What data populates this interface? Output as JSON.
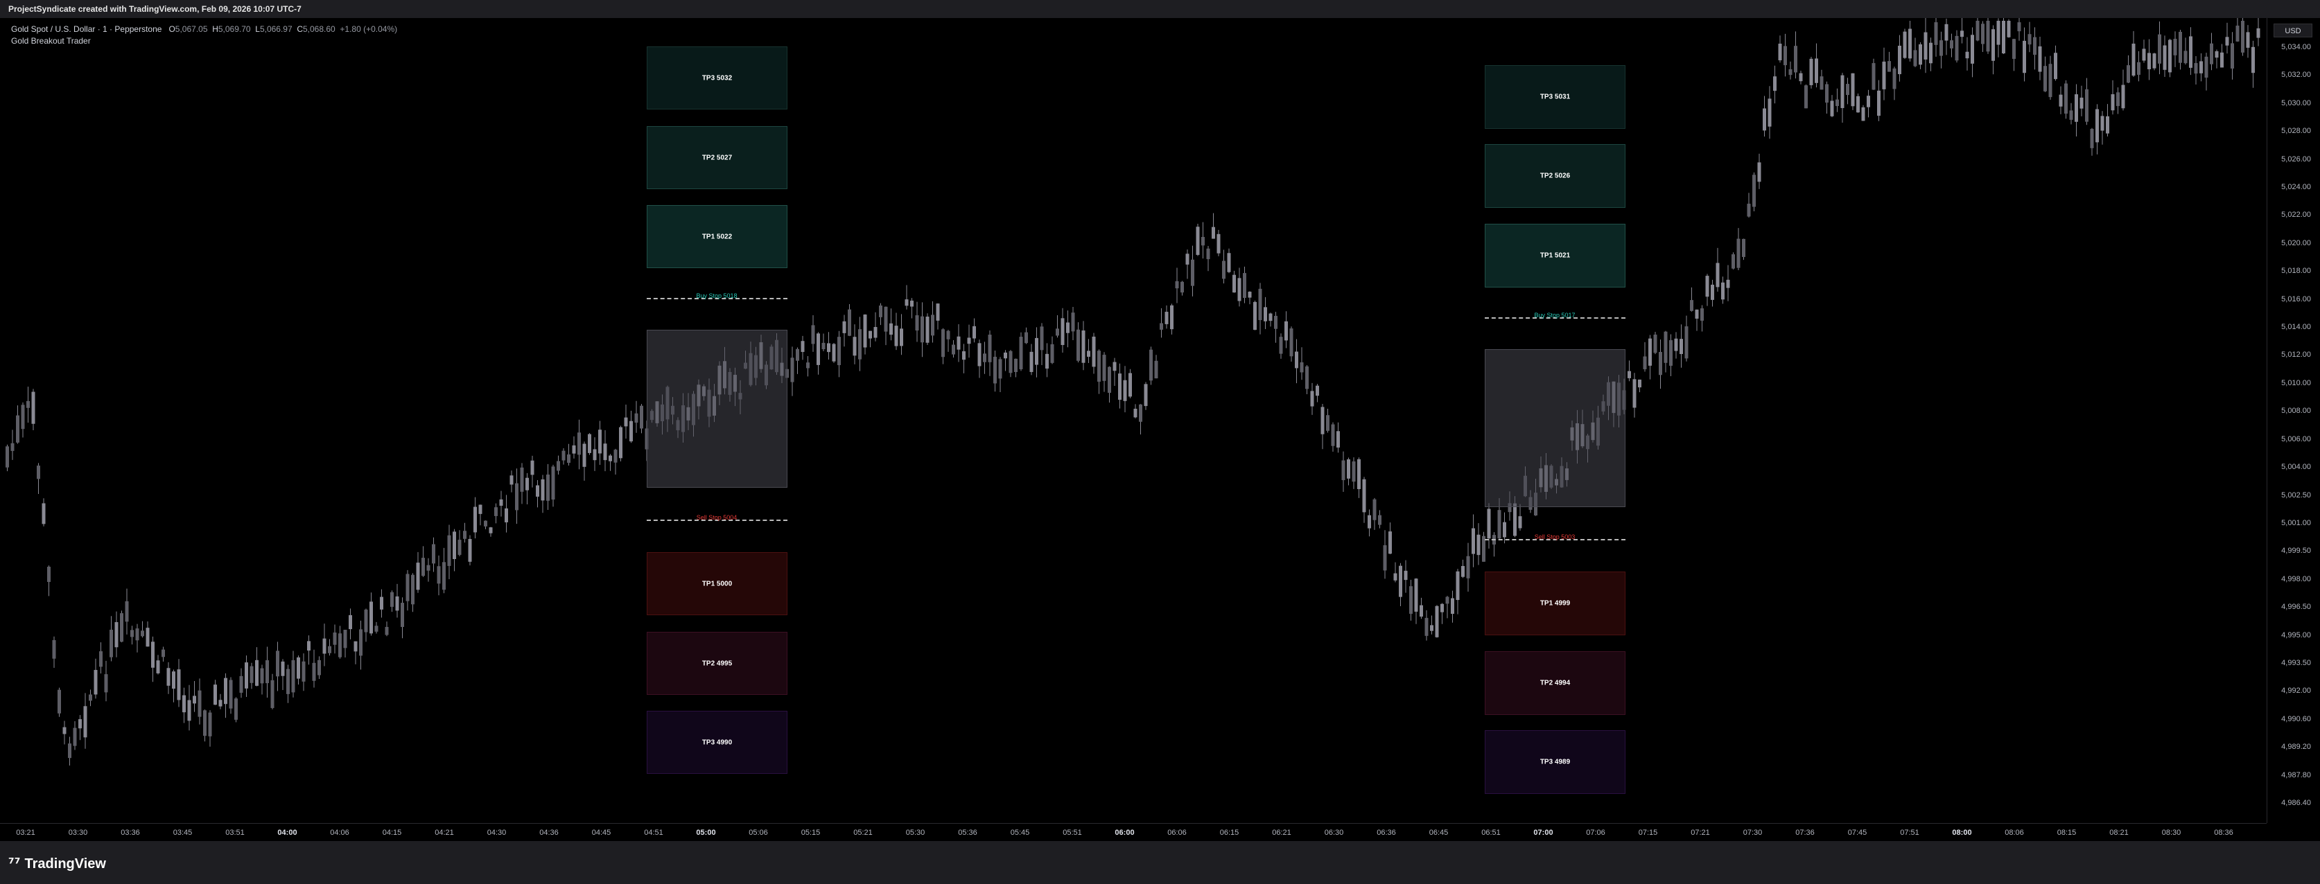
{
  "header": {
    "title": "ProjectSyndicate created with TradingView.com, Feb 09, 2026 10:07 UTC-7"
  },
  "legend": {
    "symbol": "Gold Spot / U.S. Dollar · 1 · Pepperstone",
    "open_label": "O",
    "open": "5,067.05",
    "high_label": "H",
    "high": "5,069.70",
    "low_label": "L",
    "low": "5,066.97",
    "close_label": "C",
    "close": "5,068.60",
    "change": "+1.80 (+0.04%)",
    "indicator": "Gold Breakout Trader"
  },
  "price_axis": {
    "currency": "USD",
    "labels": [
      "5,034.00",
      "5,032.00",
      "5,030.00",
      "5,028.00",
      "5,026.00",
      "5,024.00",
      "5,022.00",
      "5,020.00",
      "5,018.00",
      "5,016.00",
      "5,014.00",
      "5,012.00",
      "5,010.00",
      "5,008.00",
      "5,006.00",
      "5,004.00",
      "5,002.50",
      "5,001.00",
      "4,999.50",
      "4,998.00",
      "4,996.50",
      "4,995.00",
      "4,993.50",
      "4,992.00",
      "4,990.60",
      "4,989.20",
      "4,987.80",
      "4,986.40"
    ]
  },
  "time_axis": {
    "labels": [
      "03:21",
      "03:30",
      "03:36",
      "03:45",
      "03:51",
      "04:00",
      "04:06",
      "04:15",
      "04:21",
      "04:30",
      "04:36",
      "04:45",
      "04:51",
      "05:00",
      "05:06",
      "05:15",
      "05:21",
      "05:30",
      "05:36",
      "05:45",
      "05:51",
      "06:00",
      "06:06",
      "06:15",
      "06:21",
      "06:30",
      "06:36",
      "06:45",
      "06:51",
      "07:00",
      "07:06",
      "07:15",
      "07:21",
      "07:30",
      "07:36",
      "07:45",
      "07:51",
      "08:00",
      "08:06",
      "08:15",
      "08:21",
      "08:30",
      "08:36"
    ],
    "bold": [
      "04:00",
      "05:00",
      "06:00",
      "07:00",
      "08:00"
    ]
  },
  "zones": {
    "left": {
      "tp3_buy": "TP3 5032",
      "tp2_buy": "TP2 5027",
      "tp1_buy": "TP1 5022",
      "buy_stop": "Buy Stop 5018",
      "sell_stop": "Sell Stop 5004",
      "tp1_sell": "TP1 5000",
      "tp2_sell": "TP2 4995",
      "tp3_sell": "TP3 4990"
    },
    "right": {
      "tp3_buy": "TP3 5031",
      "tp2_buy": "TP2 5026",
      "tp1_buy": "TP1 5021",
      "buy_stop": "Buy Stop 5017",
      "sell_stop": "Sell Stop 5003",
      "tp1_sell": "TP1 4999",
      "tp2_sell": "TP2 4994",
      "tp3_sell": "TP3 4989"
    }
  },
  "colors": {
    "background": "#000000",
    "candle": "#8a8a94",
    "buy_zone": "#0c2422",
    "buy_border": "#1f4a44",
    "sell_zone_1": "#2a0707",
    "sell_zone_2": "#1f0712",
    "sell_zone_3": "#12071c",
    "buy_stop": "#26c6b4",
    "sell_stop": "#e53935",
    "range_box": "#3a3a40"
  },
  "footer": {
    "brand": "TradingView"
  }
}
